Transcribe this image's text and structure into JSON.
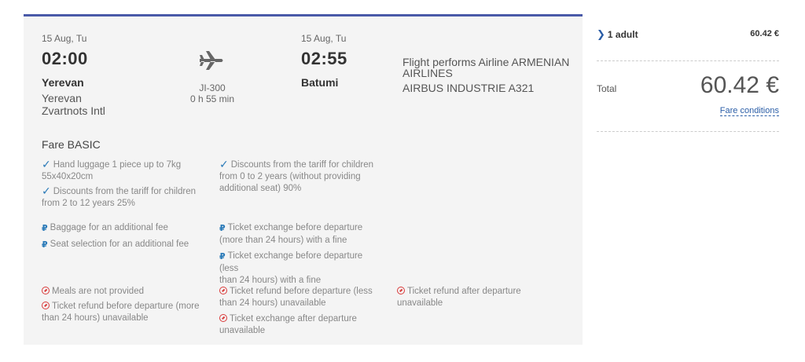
{
  "flight": {
    "departure": {
      "date": "15 Aug, Tu",
      "time": "02:00",
      "city": "Yerevan",
      "airport_line1": "Yerevan",
      "airport_line2": "Zvartnots Intl"
    },
    "arrival": {
      "date": "15 Aug, Tu",
      "time": "02:55",
      "city": "Batumi"
    },
    "flight_number": "JI-300",
    "duration": "0 h 55 min",
    "operator_line1": "Flight performs Airline ARMENIAN",
    "operator_line2": "AIRLINES",
    "aircraft": "AIRBUS INDUSTRIE A321"
  },
  "fare": {
    "title": "Fare BASIC",
    "included": [
      {
        "line1": "Hand luggage 1 piece up to 7kg",
        "line2": "55x40x20cm"
      },
      {
        "line1": "Discounts from the tariff for children",
        "line2": "from 2 to 12 years 25%"
      },
      {
        "line1": "Discounts from the tariff for children",
        "line2": "from 0 to 2 years (without providing",
        "line3": "additional seat) 90%"
      }
    ],
    "paid": [
      {
        "line1": "Baggage for an additional fee"
      },
      {
        "line1": "Seat selection for an additional fee"
      },
      {
        "line1": "Ticket exchange before departure",
        "line2": "(more than 24 hours) with a fine"
      },
      {
        "line1": "Ticket exchange before departure (less",
        "line2": "than 24 hours) with a fine"
      }
    ],
    "unavailable": [
      {
        "line1": "Meals are not provided"
      },
      {
        "line1": "Ticket refund before departure (more",
        "line2": "than 24 hours) unavailable"
      },
      {
        "line1": "Ticket refund before departure (less",
        "line2": "than 24 hours) unavailable"
      },
      {
        "line1": "Ticket exchange after departure",
        "line2": "unavailable"
      },
      {
        "line1": "Ticket refund after departure",
        "line2": "unavailable"
      }
    ],
    "icons": {
      "included": "check-icon",
      "paid": "ruble-icon",
      "unavailable": "prohibited-icon"
    }
  },
  "summary": {
    "passengers_label": "1 adult",
    "passengers_price": "60.42 €",
    "total_label": "Total",
    "total_price": "60.42 €",
    "fare_conditions": "Fare conditions"
  },
  "colors": {
    "accent": "#4a5aa8",
    "link": "#2b5ea7",
    "check": "#2a7ab8",
    "unavailable": "#d93a3a"
  }
}
